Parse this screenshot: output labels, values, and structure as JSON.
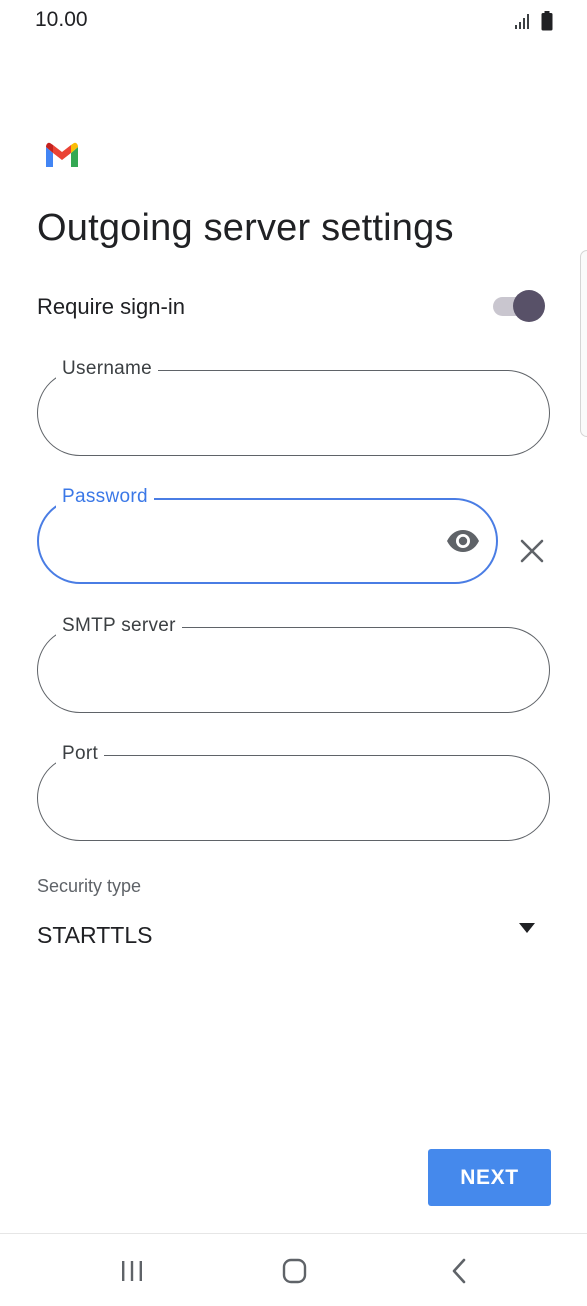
{
  "status_bar": {
    "time": "10.00",
    "icons": [
      "signal-icon",
      "battery-icon"
    ]
  },
  "app": {
    "logo": "gmail-logo"
  },
  "page": {
    "title": "Outgoing server settings"
  },
  "require_signin": {
    "label": "Require sign-in",
    "enabled": true
  },
  "fields": {
    "username": {
      "label": "Username",
      "value": ""
    },
    "password": {
      "label": "Password",
      "value": "",
      "focused": true
    },
    "smtp_server": {
      "label": "SMTP server",
      "value": ""
    },
    "port": {
      "label": "Port",
      "value": ""
    }
  },
  "security": {
    "label": "Security type",
    "selected": "STARTTLS"
  },
  "actions": {
    "next_label": "NEXT"
  },
  "navigation": {
    "items": [
      "recent-apps-icon",
      "home-icon",
      "back-icon"
    ]
  },
  "colors": {
    "accent": "#4589ec",
    "focus_border": "#4a7de4",
    "toggle_thumb": "#585168",
    "toggle_track": "#c9c6cf",
    "text_primary": "#202124",
    "text_secondary": "#5f6368"
  }
}
